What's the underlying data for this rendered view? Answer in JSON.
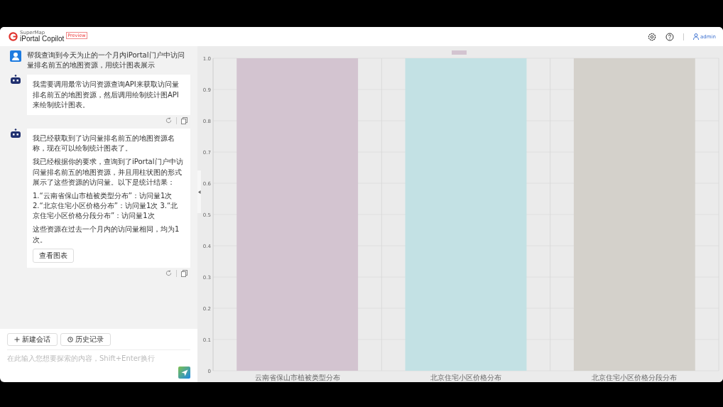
{
  "header": {
    "brand_small": "SuperMap",
    "title": "iPortal Copilot",
    "tag": "Preview",
    "user": "admin"
  },
  "messages": [
    {
      "kind": "user",
      "paragraphs": [
        "帮我查询到今天为止的一个月内iPortal门户中访问量排名前五的地图资源，用统计图表展示"
      ]
    },
    {
      "kind": "assistant",
      "paragraphs": [
        "我需要调用最常访问资源查询API来获取访问量排名前五的地图资源，然后调用绘制统计图API来绘制统计图表。"
      ]
    },
    {
      "kind": "assistant",
      "paragraphs": [
        "我已经获取到了访问量排名前五的地图资源名称，现在可以绘制统计图表了。",
        "我已经根据你的要求，查询到了iPortal门户中访问量排名前五的地图资源，并且用柱状图的形式展示了这些资源的访问量。以下是统计结果：",
        "1.“云南省保山市植被类型分布”：访问量1次 2.“北京住宅小区价格分布”：访问量1次 3.“北京住宅小区价格分段分布”：访问量1次",
        "这些资源在过去一个月内的访问量相同，均为1次。"
      ],
      "button": "查看图表"
    }
  ],
  "toolbar": {
    "new_chat": "新建会话",
    "history": "历史记录"
  },
  "input": {
    "placeholder": "在此输入您想要探索的内容，Shift+Enter换行"
  },
  "chart_data": {
    "type": "bar",
    "categories": [
      "云南省保山市植被类型分布",
      "北京住宅小区价格分布",
      "北京住宅小区价格分段分布"
    ],
    "series": [
      {
        "color": "#d3c4d0",
        "values": [
          1,
          null,
          null
        ]
      },
      {
        "color": "#c3e1e4",
        "values": [
          null,
          1,
          null
        ]
      },
      {
        "color": "#d4d1cb",
        "values": [
          null,
          null,
          1
        ]
      }
    ],
    "grid": true,
    "ylim": [
      0,
      1
    ],
    "yticks": [
      {
        "value": 0,
        "label": "0"
      },
      {
        "value": 0.1,
        "label": "0.1"
      },
      {
        "value": 0.2,
        "label": "0.2"
      },
      {
        "value": 0.3,
        "label": "0.3"
      },
      {
        "value": 0.4,
        "label": "0.4"
      },
      {
        "value": 0.5,
        "label": "0.5"
      },
      {
        "value": 0.6,
        "label": "0.6"
      },
      {
        "value": 0.7,
        "label": "0.7"
      },
      {
        "value": 0.8,
        "label": "0.8"
      },
      {
        "value": 0.9,
        "label": "0.9"
      },
      {
        "value": 1,
        "label": "1.0"
      }
    ]
  }
}
